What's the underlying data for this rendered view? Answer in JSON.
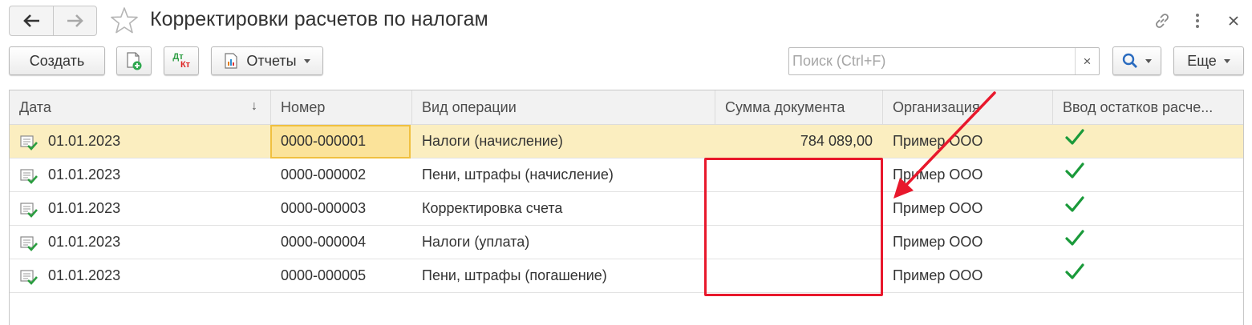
{
  "window": {
    "title": "Корректировки расчетов по налогам"
  },
  "toolbar": {
    "create_label": "Создать",
    "reports_label": "Отчеты",
    "dtkt_top": "Дт",
    "dtkt_bottom": "Кт",
    "more_label": "Еще",
    "clear_label": "×"
  },
  "search": {
    "placeholder": "Поиск (Ctrl+F)",
    "value": ""
  },
  "table": {
    "columns": [
      "Дата",
      "Номер",
      "Вид операции",
      "Сумма документа",
      "Организация",
      "Ввод остатков расче..."
    ],
    "sort_indicator": "↓",
    "rows": [
      {
        "date": "01.01.2023",
        "number": "0000-000001",
        "operation": "Налоги (начисление)",
        "sum": "784 089,00",
        "org": "Пример ООО",
        "balances": true,
        "selected": true
      },
      {
        "date": "01.01.2023",
        "number": "0000-000002",
        "operation": "Пени, штрафы (начисление)",
        "sum": "",
        "org": "Пример ООО",
        "balances": true,
        "selected": false
      },
      {
        "date": "01.01.2023",
        "number": "0000-000003",
        "operation": "Корректировка счета",
        "sum": "",
        "org": "Пример ООО",
        "balances": true,
        "selected": false
      },
      {
        "date": "01.01.2023",
        "number": "0000-000004",
        "operation": "Налоги (уплата)",
        "sum": "",
        "org": "Пример ООО",
        "balances": true,
        "selected": false
      },
      {
        "date": "01.01.2023",
        "number": "0000-000005",
        "operation": "Пени, штрафы (погашение)",
        "sum": "",
        "org": "Пример ООО",
        "balances": true,
        "selected": false
      }
    ]
  },
  "icons": {
    "back": "arrow-left-icon",
    "forward": "arrow-right-icon",
    "favorite": "star-icon",
    "link": "link-icon",
    "menu": "kebab-menu-icon",
    "close": "close-icon",
    "copy": "copy-add-icon",
    "report": "report-icon",
    "search": "search-icon",
    "row_doc": "document-posted-icon",
    "check": "checkmark-icon"
  },
  "colors": {
    "selected_row": "#fbeec0",
    "focused_cell": "#fbe39a",
    "focus_border": "#f0c040",
    "check_green": "#1a9a3a",
    "annotation_red": "#e8182c",
    "header_bg": "#f2f2f2",
    "search_blue": "#2a6bbf"
  }
}
